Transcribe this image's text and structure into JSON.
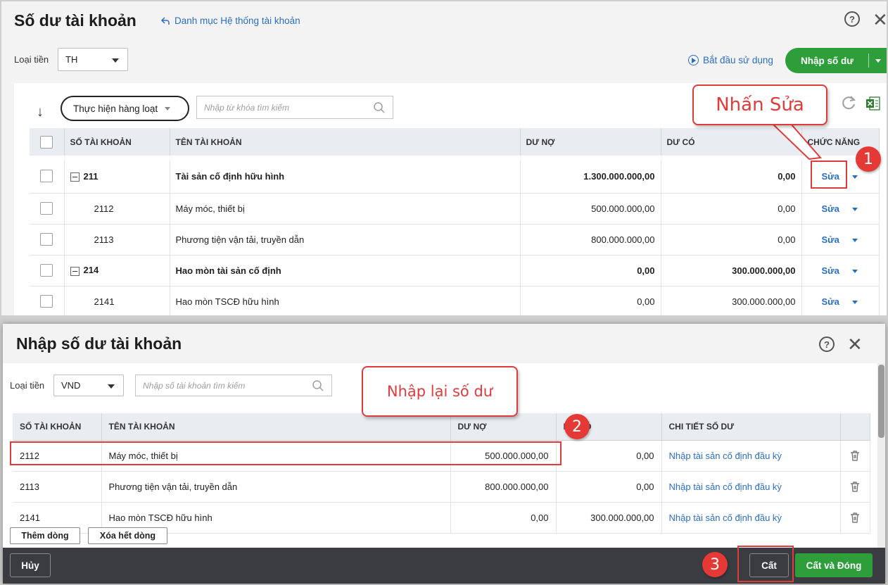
{
  "top": {
    "title": "Số dư tài khoản",
    "back_link": "Danh mục Hệ thống tài khoản",
    "help_glyph": "?",
    "close_glyph": "✕",
    "currency_label": "Loại tiền",
    "currency_value": "TH",
    "start_link": "Bắt đầu sử dụng",
    "enter_balance_button": "Nhập số dư",
    "bulk_action": "Thực hiện hàng loạt",
    "search_placeholder": "Nhập từ khóa tìm kiếm",
    "columns": [
      "SỐ TÀI KHOẢN",
      "TÊN TÀI KHOẢN",
      "DƯ NỢ",
      "DƯ CÓ",
      "CHỨC NĂNG"
    ],
    "rows": [
      {
        "code": "211",
        "name": "Tài sản cố định hữu hình",
        "debit": "1.300.000.000,00",
        "credit": "0,00",
        "action": "Sửa",
        "parent": true
      },
      {
        "code": "2112",
        "name": "Máy móc, thiết bị",
        "debit": "500.000.000,00",
        "credit": "0,00",
        "action": "Sửa",
        "parent": false
      },
      {
        "code": "2113",
        "name": "Phương tiện vận tải, truyền dẫn",
        "debit": "800.000.000,00",
        "credit": "0,00",
        "action": "Sửa",
        "parent": false
      },
      {
        "code": "214",
        "name": "Hao mòn tài sản cố định",
        "debit": "0,00",
        "credit": "300.000.000,00",
        "action": "Sửa",
        "parent": true
      },
      {
        "code": "2141",
        "name": "Hao mòn TSCĐ hữu hình",
        "debit": "0,00",
        "credit": "300.000.000,00",
        "action": "Sửa",
        "parent": false
      }
    ]
  },
  "modal": {
    "title": "Nhập số dư tài khoản",
    "help_glyph": "?",
    "close_glyph": "✕",
    "currency_label": "Loại tiền",
    "currency_value": "VND",
    "search_placeholder": "Nhập số tài khoản tìm kiếm",
    "columns": [
      "SỐ TÀI KHOẢN",
      "TÊN TÀI KHOẢN",
      "DƯ NỢ",
      "DƯ CÓ",
      "CHI TIẾT SỐ DƯ"
    ],
    "rows": [
      {
        "code": "2112",
        "name": "Máy móc, thiết bị",
        "debit": "500.000.000,00",
        "credit": "0,00",
        "detail": "Nhập tài sản cố định đầu kỳ"
      },
      {
        "code": "2113",
        "name": "Phương tiện vận tải, truyền dẫn",
        "debit": "800.000.000,00",
        "credit": "0,00",
        "detail": "Nhập tài sản cố định đầu kỳ"
      },
      {
        "code": "2141",
        "name": "Hao mòn TSCĐ hữu hình",
        "debit": "0,00",
        "credit": "300.000.000,00",
        "detail": "Nhập tài sản cố định đầu kỳ"
      }
    ],
    "add_row": "Thêm dòng",
    "clear_rows": "Xóa hết dòng",
    "cancel": "Hủy",
    "save": "Cất",
    "save_close": "Cất và Đóng"
  },
  "annotations": {
    "callout1": "Nhấn Sửa",
    "callout2": "Nhập lại số dư",
    "badge1": "1",
    "badge2": "2",
    "badge3": "3"
  },
  "colors": {
    "accent_blue": "#2a6ec4",
    "primary_green": "#2e9e3a",
    "annotation_red": "#e03b3b",
    "footer_dark": "#3a3c42"
  },
  "icons": [
    "back-arrow-icon",
    "help-icon",
    "close-icon",
    "play-icon",
    "sort-icon",
    "search-icon",
    "refresh-icon",
    "excel-icon",
    "trash-icon",
    "chevron-down-icon",
    "collapse-icon"
  ]
}
